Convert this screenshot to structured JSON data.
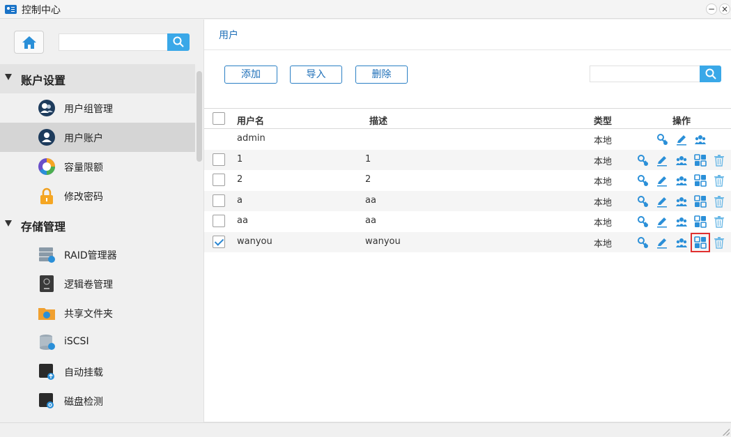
{
  "window": {
    "title": "控制中心",
    "minimize": "−",
    "close": "×"
  },
  "sidebar": {
    "search_placeholder": "",
    "groups": [
      {
        "label": "账户设置",
        "items": [
          {
            "label": "用户组管理",
            "icon": "user-group-icon"
          },
          {
            "label": "用户账户",
            "icon": "user-account-icon",
            "selected": true
          },
          {
            "label": "容量限额",
            "icon": "quota-pie-icon"
          },
          {
            "label": "修改密码",
            "icon": "lock-icon"
          }
        ]
      },
      {
        "label": "存储管理",
        "items": [
          {
            "label": "RAID管理器",
            "icon": "raid-icon"
          },
          {
            "label": "逻辑卷管理",
            "icon": "lvm-icon"
          },
          {
            "label": "共享文件夹",
            "icon": "shared-folder-icon"
          },
          {
            "label": "iSCSI",
            "icon": "iscsi-icon"
          },
          {
            "label": "自动挂载",
            "icon": "automount-icon"
          },
          {
            "label": "磁盘检测",
            "icon": "disk-check-icon"
          }
        ]
      }
    ]
  },
  "main": {
    "breadcrumb": "用户",
    "toolbar": {
      "add": "添加",
      "import": "导入",
      "delete": "删除",
      "search_placeholder": ""
    },
    "table": {
      "headers": {
        "name": "用户名",
        "desc": "描述",
        "type": "类型",
        "ops": "操作"
      },
      "rows": [
        {
          "name": "admin",
          "desc": "",
          "type": "本地",
          "checkbox": false,
          "full_ops": false,
          "checked": false
        },
        {
          "name": "1",
          "desc": "1",
          "type": "本地",
          "checkbox": true,
          "full_ops": true,
          "checked": false
        },
        {
          "name": "2",
          "desc": "2",
          "type": "本地",
          "checkbox": true,
          "full_ops": true,
          "checked": false
        },
        {
          "name": "a",
          "desc": "aa",
          "type": "本地",
          "checkbox": true,
          "full_ops": true,
          "checked": false
        },
        {
          "name": "aa",
          "desc": "aa",
          "type": "本地",
          "checkbox": true,
          "full_ops": true,
          "checked": false
        },
        {
          "name": "wanyou",
          "desc": "wanyou",
          "type": "本地",
          "checkbox": true,
          "full_ops": true,
          "checked": true
        }
      ],
      "op_icons": [
        "key-user-icon",
        "edit-pencil-icon",
        "user-group-op-icon",
        "grid-apps-icon",
        "trash-icon"
      ]
    }
  },
  "colors": {
    "accent": "#3aa8e8",
    "link": "#1e6fb8",
    "highlight": "#e03030"
  }
}
